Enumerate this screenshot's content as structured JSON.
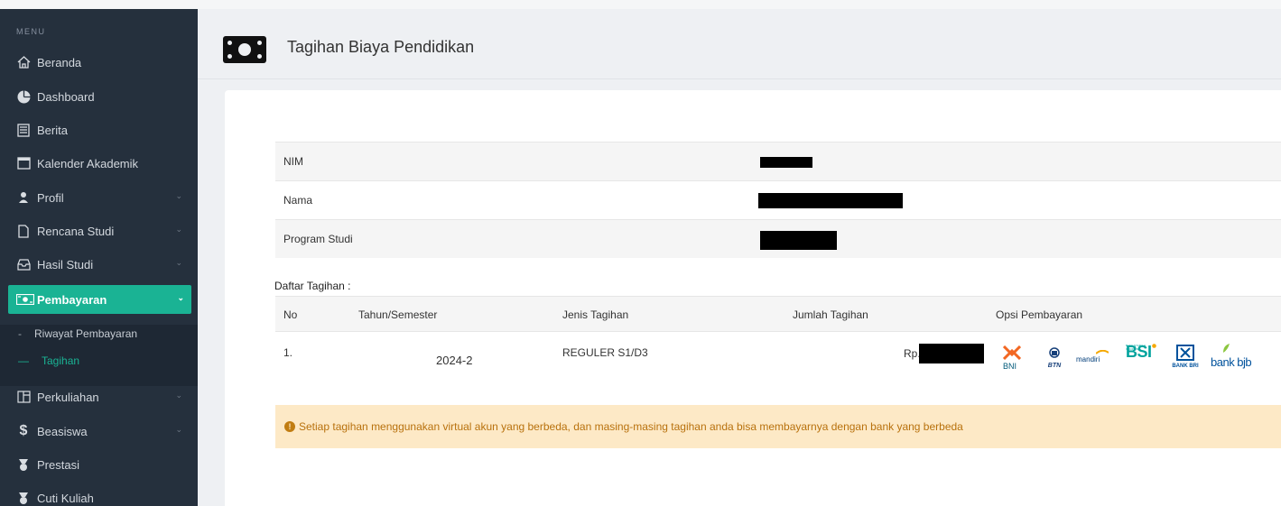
{
  "sidebar": {
    "menu_heading": "MENU",
    "items": [
      {
        "label": "Beranda",
        "icon": "home-icon"
      },
      {
        "label": "Dashboard",
        "icon": "pie-chart-icon"
      },
      {
        "label": "Berita",
        "icon": "news-icon"
      },
      {
        "label": "Kalender Akademik",
        "icon": "calendar-icon"
      },
      {
        "label": "Profil",
        "icon": "user-icon",
        "has_submenu": true
      },
      {
        "label": "Rencana Studi",
        "icon": "file-icon",
        "has_submenu": true
      },
      {
        "label": "Hasil Studi",
        "icon": "inbox-icon",
        "has_submenu": true
      },
      {
        "label": "Pembayaran",
        "icon": "money-icon",
        "has_submenu": true,
        "active": true
      },
      {
        "label": "Perkuliahan",
        "icon": "layout-icon",
        "has_submenu": true
      },
      {
        "label": "Beasiswa",
        "icon": "dollar-icon",
        "has_submenu": true
      },
      {
        "label": "Prestasi",
        "icon": "medal-icon"
      },
      {
        "label": "Cuti Kuliah",
        "icon": "medal-icon"
      }
    ],
    "submenu": [
      {
        "label": "Riwayat Pembayaran",
        "marker": "-"
      },
      {
        "label": "Tagihan",
        "marker": "—",
        "active": true
      }
    ]
  },
  "header": {
    "title": "Tagihan Biaya Pendidikan",
    "icon": "money-bill-icon"
  },
  "info": [
    {
      "label": "NIM",
      "value": "[redacted]"
    },
    {
      "label": "Nama",
      "value": "[redacted]"
    },
    {
      "label": "Program Studi",
      "value": "[redacted]"
    }
  ],
  "daftar_label": "Daftar Tagihan :",
  "table": {
    "columns": [
      "No",
      "Tahun/Semester",
      "Jenis Tagihan",
      "Jumlah Tagihan",
      "Opsi Pembayaran"
    ],
    "rows": [
      {
        "no": "1.",
        "tahun": "2024-2",
        "jenis": "REGULER S1/D3",
        "jumlah_prefix": "Rp."
      }
    ]
  },
  "banks": {
    "bni": "BNI",
    "btn": "BTN",
    "mandiri": "mandiri",
    "bsi": "BSI",
    "bsi_sub": "BANK SYARIAH INDONESIA",
    "bri": "BANK BRI",
    "bjb": "bank bjb"
  },
  "alert": {
    "icon": "exclamation-circle-icon",
    "text": "Setiap tagihan menggunakan virtual akun yang berbeda, dan masing-masing tagihan anda bisa membayarnya dengan bank yang berbeda"
  },
  "colors": {
    "sidebar_bg": "#25303d",
    "accent": "#1ab394",
    "alert_bg": "#fde9c6",
    "alert_text": "#b8710d"
  }
}
